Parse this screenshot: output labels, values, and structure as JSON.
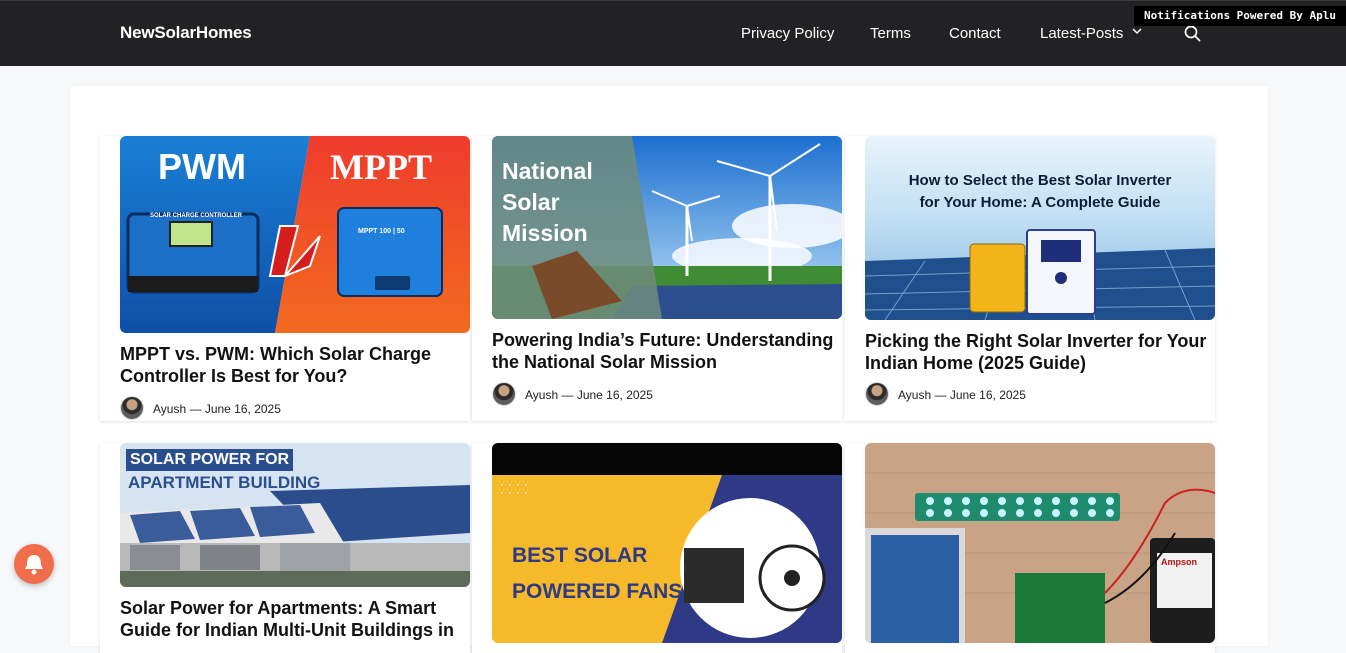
{
  "header": {
    "brand": "NewSolarHomes",
    "nav": [
      "Privacy Policy",
      "Terms",
      "Contact",
      "Latest-Posts"
    ],
    "icons": [
      "chevron-down-icon",
      "search-icon"
    ]
  },
  "notification_bar": "Notifications Powered By Aplu",
  "colors": {
    "header_bg": "#222224",
    "bell": "#f26d4b"
  },
  "posts": [
    {
      "title": "MPPT vs. PWM: Which Solar Charge Controller Is Best for You?",
      "author": "Ayush",
      "date": "June 16, 2025",
      "image": {
        "left_text": "PWM",
        "right_text": "MPPT",
        "vs": "VS",
        "device_label_left": "SOLAR CHARGE CONTROLLER",
        "device_label_right": "MPPT 100 | 50"
      }
    },
    {
      "title": "Powering India’s Future: Understanding the National Solar Mission",
      "author": "Ayush",
      "date": "June 16, 2025",
      "image": {
        "lines": [
          "National",
          "Solar",
          "Mission"
        ]
      }
    },
    {
      "title": "Picking the Right Solar Inverter for Your Indian Home (2025 Guide)",
      "author": "Ayush",
      "date": "June 16, 2025",
      "image": {
        "lines": [
          "How to Select the Best Solar Inverter",
          "for Your Home: A Complete Guide"
        ]
      }
    },
    {
      "title": "Solar Power for Apartments: A Smart Guide for Indian Multi-Unit Buildings in",
      "image": {
        "lines": [
          "SOLAR POWER FOR",
          "APARTMENT BUILDING"
        ]
      }
    },
    {
      "title": "",
      "image": {
        "lines": [
          "BEST SOLAR",
          "POWERED FANS"
        ]
      }
    },
    {
      "title": "",
      "image": {
        "label": "Ampson"
      }
    }
  ],
  "meta_separator": "—"
}
